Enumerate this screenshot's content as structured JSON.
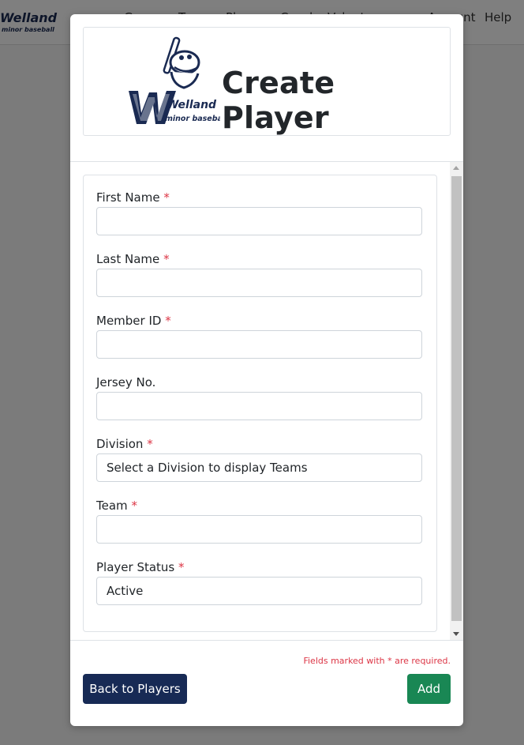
{
  "nav": {
    "logo_text": "Welland minor baseball",
    "items": [
      "Games",
      "Teams",
      "Players",
      "Coaches",
      "Volunteers",
      "Account",
      "Help"
    ]
  },
  "modal": {
    "title": "Create Player",
    "logo_text_top": "Welland",
    "logo_text_bottom": "minor baseball",
    "fields": {
      "first_name": {
        "label": "First Name",
        "required_mark": "*",
        "value": ""
      },
      "last_name": {
        "label": "Last Name",
        "required_mark": "*",
        "value": ""
      },
      "member_id": {
        "label": "Member ID",
        "required_mark": "*",
        "value": ""
      },
      "jersey_no": {
        "label": "Jersey No.",
        "value": ""
      },
      "division": {
        "label": "Division",
        "required_mark": "*",
        "selected": "Select a Division to display Teams"
      },
      "team": {
        "label": "Team",
        "required_mark": "*",
        "selected": ""
      },
      "player_status": {
        "label": "Player Status",
        "required_mark": "*",
        "selected": "Active"
      }
    },
    "required_note": "Fields marked with * are required.",
    "back_button": "Back to Players",
    "add_button": "Add"
  },
  "colors": {
    "primary_navy": "#172a55",
    "success_green": "#198754",
    "required_red": "#dc3545"
  }
}
